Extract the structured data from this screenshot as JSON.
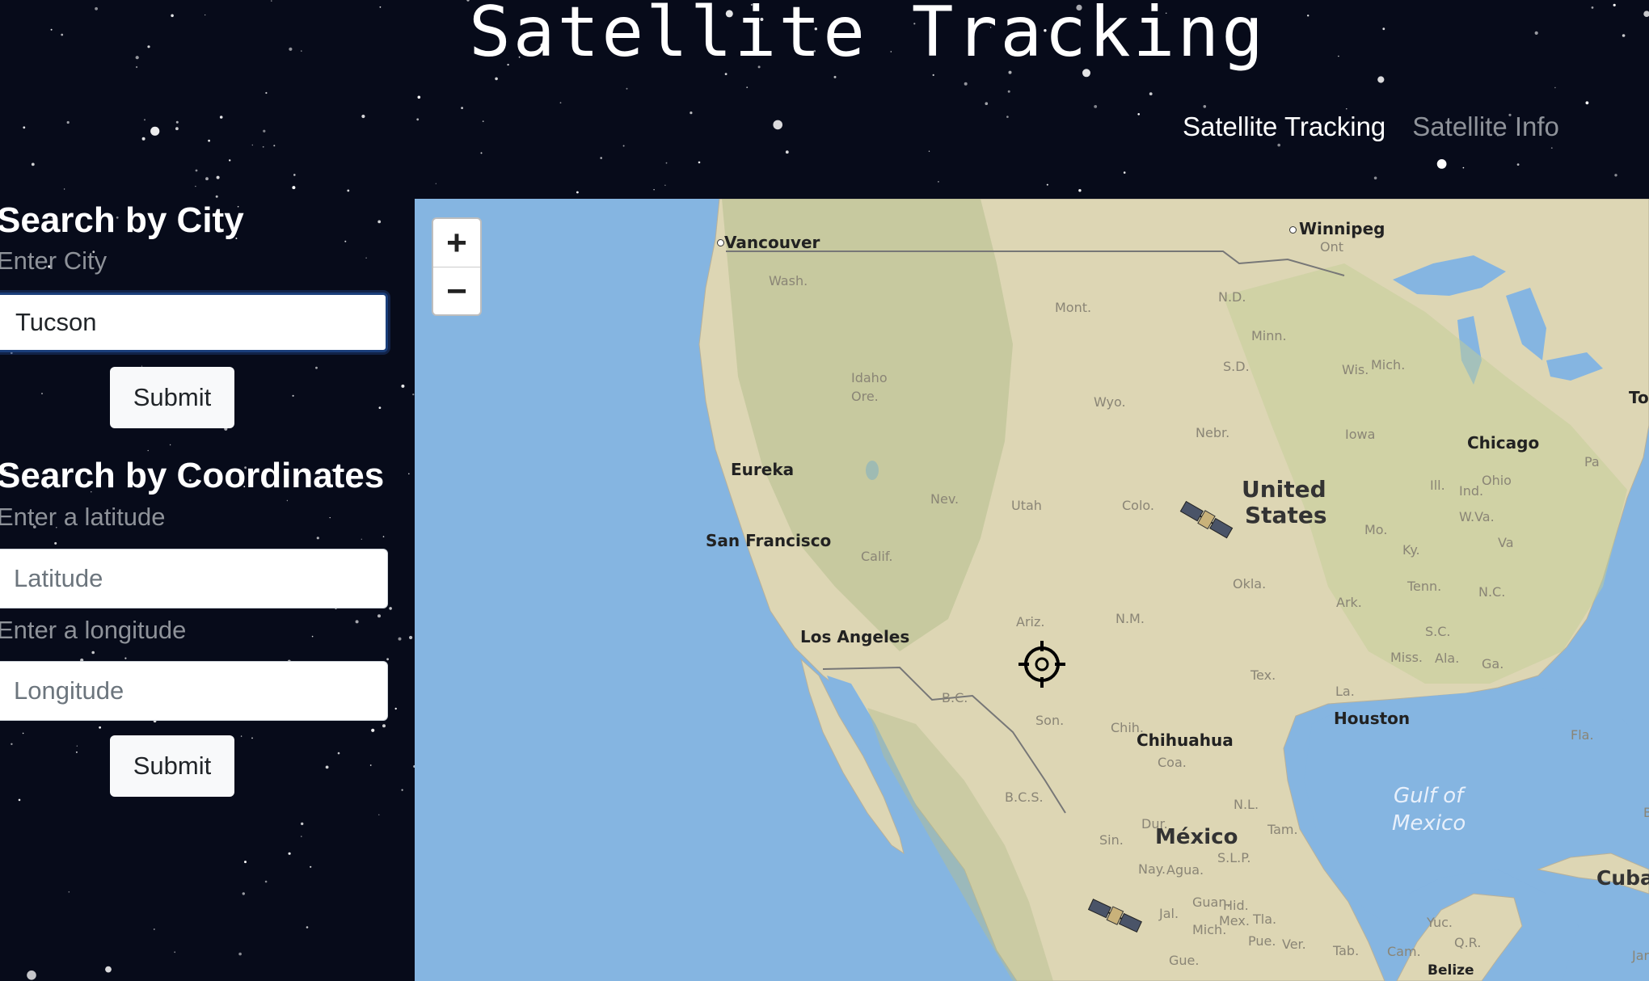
{
  "header": {
    "title": "Satellite Tracking"
  },
  "nav": {
    "items": [
      "Satellite Tracking",
      "Satellite Info"
    ]
  },
  "city_search": {
    "heading": "Search by City",
    "label": "Enter City",
    "value": "Tucson",
    "submit_label": "Submit"
  },
  "coord_search": {
    "heading": "Search by Coordinates",
    "lat_label": "Enter a latitude",
    "lat_placeholder": "Latitude",
    "lon_label": "Enter a longitude",
    "lon_placeholder": "Longitude",
    "submit_label": "Submit"
  },
  "map": {
    "zoom_in": "+",
    "zoom_out": "−",
    "cities": [
      "Vancouver",
      "Winnipeg",
      "Eureka",
      "San Francisco",
      "Los Angeles",
      "Chicago",
      "Houston",
      "Chihuahua",
      "To",
      "Belize"
    ],
    "countries": [
      "United",
      "States",
      "México",
      "Cuba"
    ],
    "water": [
      "Gulf of",
      "Mexico"
    ],
    "regions": [
      "Wash.",
      "Mont.",
      "N.D.",
      "Minn.",
      "Ont",
      "S.D.",
      "Wis.",
      "Mich.",
      "Idaho",
      "Ore.",
      "Wyo.",
      "Nebr.",
      "Iowa",
      "Ill.",
      "Ind.",
      "Ohio",
      "Pa",
      "Nev.",
      "Utah",
      "Colo.",
      "Mo.",
      "Ky.",
      "W.Va.",
      "Va",
      "Calif.",
      "Okla.",
      "Tenn.",
      "N.C.",
      "Ark.",
      "S.C.",
      "Ariz.",
      "N.M.",
      "Miss.",
      "Ala.",
      "Ga.",
      "Tex.",
      "La.",
      "B.C.",
      "Son.",
      "Chih.",
      "Fla.",
      "Coa.",
      "B.C.S.",
      "N.L.",
      "Dur.",
      "Tam.",
      "Sin.",
      "S.L.P.",
      "Nay.",
      "Agua.",
      "Guan.",
      "Hid.",
      "Jal.",
      "Mex.",
      "Tla.",
      "Mich.",
      "Pue.",
      "Ver.",
      "Gue.",
      "Tab.",
      "Cam.",
      "Yuc.",
      "Q.R.",
      "B",
      "Jar"
    ]
  },
  "colors": {
    "background": "#070b1a",
    "water": "#85b5e1",
    "land": "#dcd5b2",
    "nav_inactive": "#8e9299"
  }
}
